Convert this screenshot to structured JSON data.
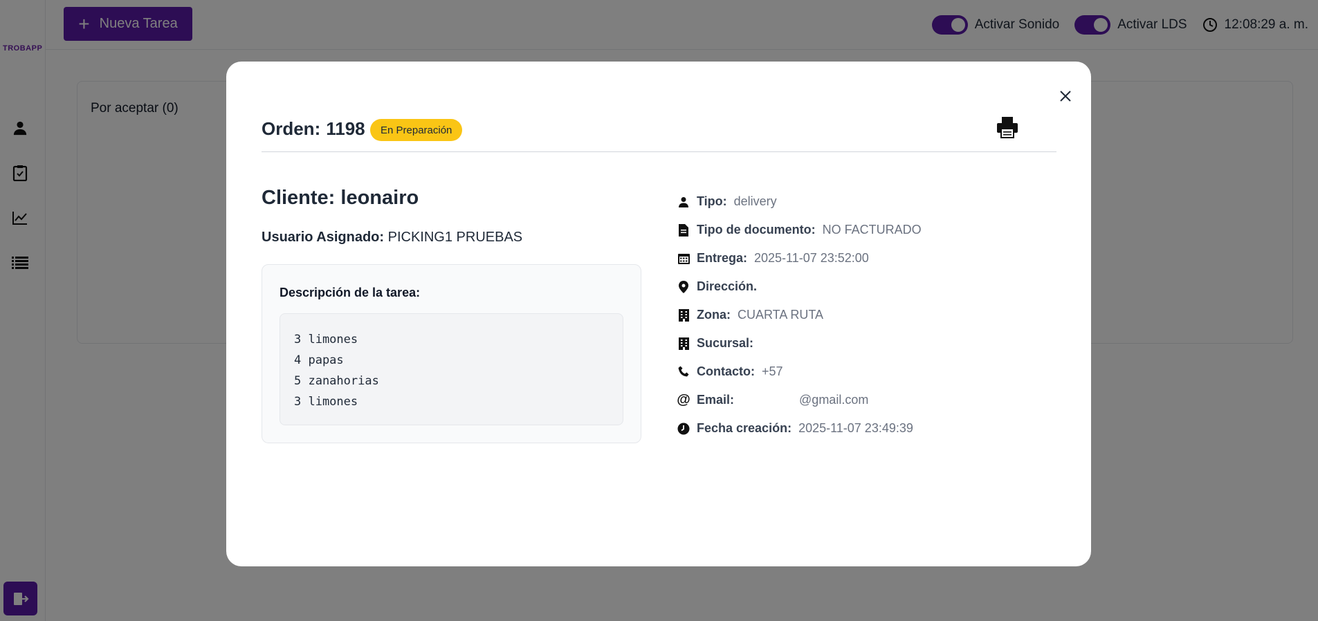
{
  "app": {
    "logo_text": "TROBAPP"
  },
  "sidebar": {
    "items": [
      {
        "icon": "user-icon"
      },
      {
        "icon": "clipboard-icon"
      },
      {
        "icon": "chart-line-icon"
      },
      {
        "icon": "list-icon"
      }
    ],
    "logout_icon": "logout-icon"
  },
  "topbar": {
    "new_task_label": "Nueva Tarea",
    "sound_toggle_label": "Activar Sonido",
    "lds_toggle_label": "Activar LDS",
    "clock": "12:08:29 a. m."
  },
  "board": {
    "column_title": "Por aceptar (0)"
  },
  "modal": {
    "order_label": "Orden:",
    "order_number": "1198",
    "status": "En Preparación",
    "client_label": "Cliente:",
    "client_name": "leonairo",
    "assigned_label": "Usuario Asignado:",
    "assigned_value": "PICKING1 PRUEBAS",
    "description_title": "Descripción de la tarea:",
    "description_lines": [
      "3 limones",
      "4 papas",
      "5 zanahorias",
      "3 limones"
    ],
    "details": {
      "tipo_label": "Tipo:",
      "tipo_value": "delivery",
      "doc_label": "Tipo de documento:",
      "doc_value": "NO FACTURADO",
      "entrega_label": "Entrega:",
      "entrega_value": "2025-11-07 23:52:00",
      "direccion_label": "Dirección.",
      "direccion_value": "",
      "zona_label": "Zona:",
      "zona_value": "CUARTA RUTA",
      "sucursal_label": "Sucursal:",
      "sucursal_value": "",
      "contacto_label": "Contacto:",
      "contacto_value": "+57",
      "email_label": "Email:",
      "email_value": "@gmail.com",
      "fecha_label": "Fecha creación:",
      "fecha_value": "2025-11-07 23:49:39"
    }
  },
  "colors": {
    "accent": "#5b1aa8",
    "badge": "#fac515"
  }
}
